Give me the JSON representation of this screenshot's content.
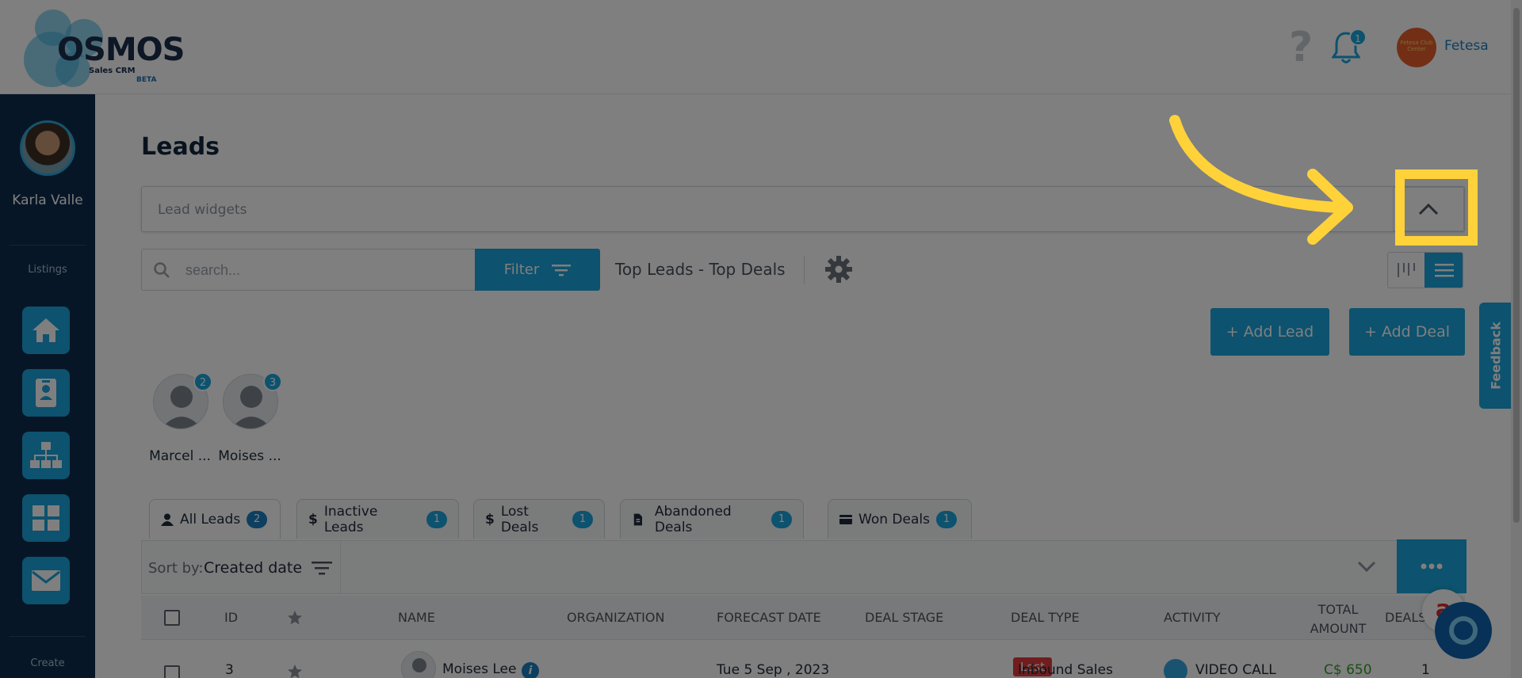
{
  "header": {
    "logo_text": "OSMOS",
    "logo_sub": "Sales CRM",
    "logo_beta": "BETA",
    "help_icon": "question-icon",
    "notification_count": "1",
    "company_name": "Fetesa",
    "company_logo_text": "Fetesa Club Center"
  },
  "sidebar": {
    "user_name": "Karla Valle",
    "section_listings": "Listings",
    "section_create": "Create",
    "items": [
      {
        "icon": "home-icon"
      },
      {
        "icon": "contacts-icon"
      },
      {
        "icon": "org-chart-icon"
      },
      {
        "icon": "dashboard-grid-icon"
      },
      {
        "icon": "mail-icon"
      }
    ]
  },
  "main": {
    "title": "Leads",
    "widgets_label": "Lead widgets",
    "search_placeholder": "search...",
    "filter_label": "Filter",
    "top_leads_label": "Top Leads - Top Deals",
    "add_lead_label": "+ Add Lead",
    "add_deal_label": "+ Add Deal",
    "feedback_label": "Feedback"
  },
  "owners": [
    {
      "name": "Marcel ...",
      "count": "2"
    },
    {
      "name": "Moises ...",
      "count": "3"
    }
  ],
  "tabs": [
    {
      "label": "All Leads",
      "count": "2",
      "icon": "person-icon"
    },
    {
      "label": "Inactive Leads",
      "count": "1",
      "icon": "dollar-icon"
    },
    {
      "label": "Lost Deals",
      "count": "1",
      "icon": "dollar-icon"
    },
    {
      "label": "Abandoned Deals",
      "count": "1",
      "icon": "file-icon"
    },
    {
      "label": "Won Deals",
      "count": "1",
      "icon": "card-icon"
    }
  ],
  "sort": {
    "label": "Sort by:",
    "value": "Created date"
  },
  "table": {
    "headers": {
      "id": "ID",
      "name": "NAME",
      "organization": "ORGANIZATION",
      "forecast_date": "FORECAST DATE",
      "deal_stage": "DEAL STAGE",
      "deal_type": "DEAL TYPE",
      "activity": "ACTIVITY",
      "total_amount_1": "TOTAL",
      "total_amount_2": "AMOUNT",
      "deals": "DEALS"
    },
    "rows": [
      {
        "id": "3",
        "name": "Moises Lee",
        "organization": "",
        "forecast_date": "Tue 5 Sep , 2023",
        "deal_stage": "Lost",
        "deal_type": "Inbound Sales",
        "activity": "VIDEO CALL",
        "total_amount": "C$ 650",
        "deals": "1"
      }
    ]
  },
  "colors": {
    "accent": "#1aa5dc",
    "sidebar": "#0f2d4c",
    "lost": "#e23b3b",
    "highlight": "#ffd23a",
    "amount": "#35a02a"
  }
}
